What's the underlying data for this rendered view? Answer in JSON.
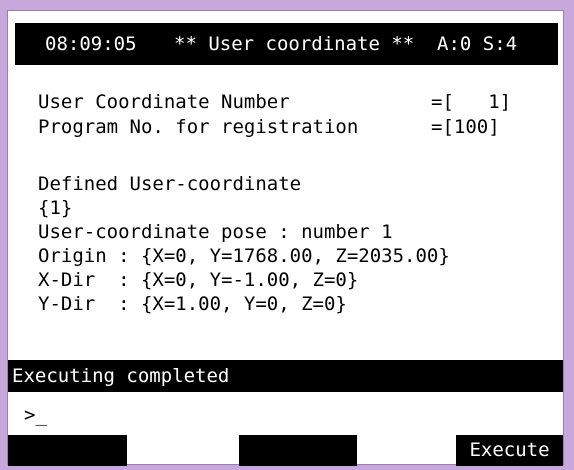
{
  "header": {
    "time": "08:09:05",
    "title": "** User coordinate **",
    "status": "A:0 S:4"
  },
  "form": {
    "user_coord_number_label": "User Coordinate Number",
    "user_coord_number_value": "=[   1]",
    "program_no_label": "Program No. for registration",
    "program_no_value": "=[100]"
  },
  "defined": {
    "heading": "Defined User-coordinate",
    "index": "{1}",
    "pose_line": "User-coordinate pose : number 1",
    "origin": "Origin : {X=0, Y=1768.00, Z=2035.00}",
    "x_dir": "X-Dir  : {X=0, Y=-1.00, Z=0}",
    "y_dir": "Y-Dir  : {X=1.00, Y=0, Z=0}"
  },
  "message": "Executing completed",
  "prompt": ">_",
  "function_keys": {
    "f1": "",
    "f2": "",
    "f3": "Execute"
  },
  "colors": {
    "frame": "#c8a8dc",
    "bar": "#000000",
    "bar_text": "#ffffff"
  }
}
